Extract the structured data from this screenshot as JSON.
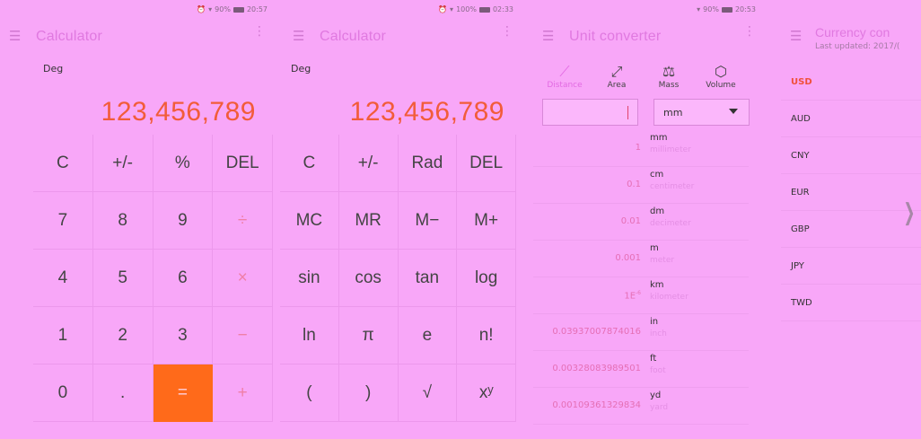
{
  "panels": [
    {
      "status": {
        "time": "20:57",
        "battery": "90%"
      },
      "title": "Calculator",
      "mode": "Deg",
      "display": "123,456,789",
      "keys": [
        "C",
        "+/-",
        "%",
        "DEL",
        "7",
        "8",
        "9",
        "÷",
        "4",
        "5",
        "6",
        "×",
        "1",
        "2",
        "3",
        "−",
        "0",
        ".",
        "=",
        "+"
      ]
    },
    {
      "status": {
        "time": "02:33",
        "battery": "100%"
      },
      "title": "Calculator",
      "mode": "Deg",
      "display": "123,456,789",
      "keys": [
        "C",
        "+/-",
        "Rad",
        "DEL",
        "MC",
        "MR",
        "M−",
        "M+",
        "sin",
        "cos",
        "tan",
        "log",
        "ln",
        "π",
        "e",
        "n!",
        "(",
        ")",
        "√",
        "xʸ"
      ]
    }
  ],
  "converter": {
    "status": {
      "time": "20:53",
      "battery": "90%"
    },
    "title": "Unit converter",
    "categories": [
      {
        "label": "Distance",
        "icon": "ruler-icon"
      },
      {
        "label": "Area",
        "icon": "expand-icon"
      },
      {
        "label": "Mass",
        "icon": "weight-icon"
      },
      {
        "label": "Volume",
        "icon": "cube-icon"
      }
    ],
    "input_value": "",
    "selected_unit": "mm",
    "rows": [
      {
        "value": "1",
        "abbr": "mm",
        "name": "millimeter"
      },
      {
        "value": "0.1",
        "abbr": "cm",
        "name": "centimeter"
      },
      {
        "value": "0.01",
        "abbr": "dm",
        "name": "decimeter"
      },
      {
        "value": "0.001",
        "abbr": "m",
        "name": "meter"
      },
      {
        "value": "1E",
        "sup": "-6",
        "abbr": "km",
        "name": "kilometer"
      },
      {
        "value": "0.03937007874016",
        "abbr": "in",
        "name": "inch"
      },
      {
        "value": "0.00328083989501",
        "abbr": "ft",
        "name": "foot"
      },
      {
        "value": "0.00109361329834",
        "abbr": "yd",
        "name": "yard"
      }
    ]
  },
  "currency": {
    "title": "Currency con",
    "subtitle": "Last updated: 2017/(",
    "items": [
      "USD",
      "AUD",
      "CNY",
      "EUR",
      "GBP",
      "JPY",
      "TWD"
    ]
  },
  "colors": {
    "accent": "#e079e0",
    "display": "#f25c3a",
    "equals": "#ff6a1a"
  }
}
